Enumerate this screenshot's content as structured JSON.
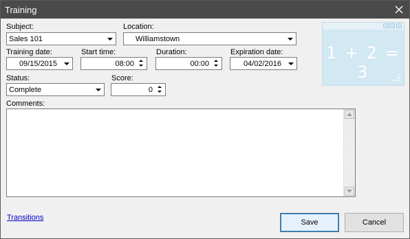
{
  "window": {
    "title": "Training"
  },
  "form": {
    "subject": {
      "label": "Subject:",
      "value": "Sales 101"
    },
    "location": {
      "label": "Location:",
      "value": "Williamstown"
    },
    "training_date": {
      "label": "Training date:",
      "value": "09/15/2015"
    },
    "start_time": {
      "label": "Start time:",
      "value": "08:00"
    },
    "duration": {
      "label": "Duration:",
      "value": "00:00"
    },
    "expiration_date": {
      "label": "Expiration date:",
      "value": "04/02/2016"
    },
    "status": {
      "label": "Status:",
      "value": "Complete"
    },
    "score": {
      "label": "Score:",
      "value": "0"
    },
    "comments": {
      "label": "Comments:",
      "value": ""
    }
  },
  "preview_image": {
    "equation": "1 + 2 = 3"
  },
  "footer": {
    "link_label": "Transitions",
    "save_label": "Save",
    "cancel_label": "Cancel"
  },
  "icons": [
    "close-icon",
    "chevron-down-icon",
    "spin-up-icon",
    "spin-down-icon",
    "scroll-up-icon",
    "scroll-down-icon"
  ]
}
